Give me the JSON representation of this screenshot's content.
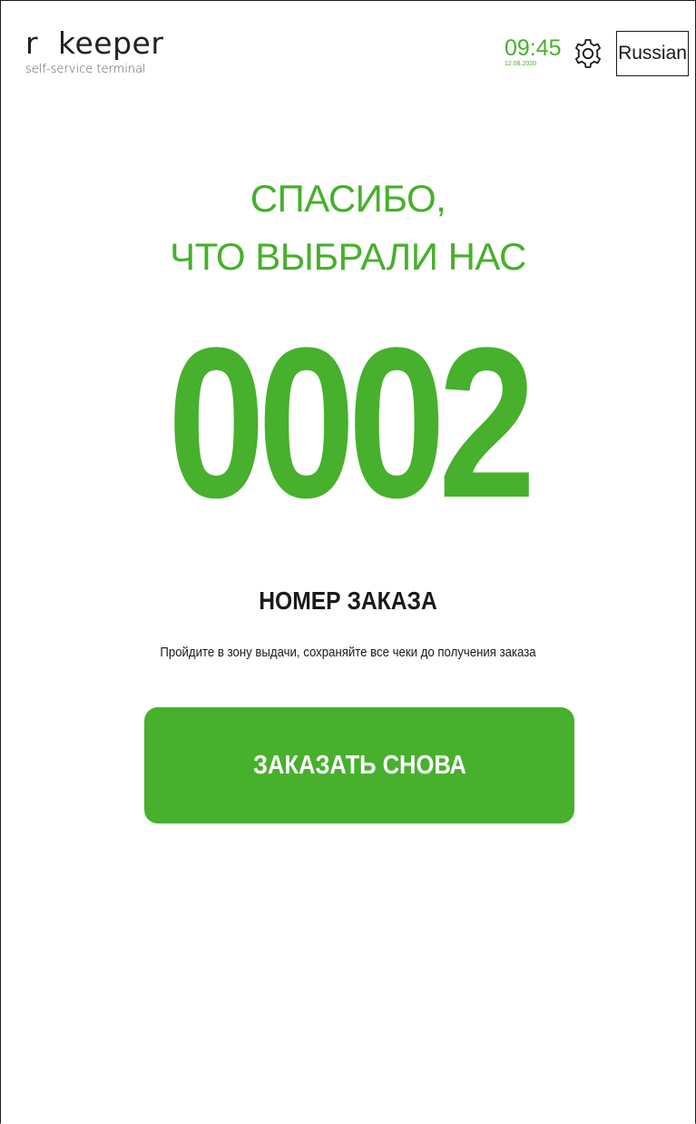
{
  "header": {
    "logo_title": "r  keeper",
    "logo_subtitle": "self-service terminal",
    "time": "09:45",
    "date": "12.08.2020",
    "settings_icon": "gear-icon",
    "language_label": "Russian"
  },
  "main": {
    "thanks_line1": "СПАСИБО,",
    "thanks_line2": "ЧТО ВЫБРАЛИ НАС",
    "order_number": "0002",
    "order_label": "НОМЕР ЗАКАЗА",
    "instruction": "Пройдите в зону выдачи, сохраняйте все чеки до получения заказа",
    "order_again_label": "ЗАКАЗАТЬ СНОВА"
  },
  "colors": {
    "accent": "#47b02c",
    "text": "#1a1a1a",
    "background": "#ffffff"
  }
}
